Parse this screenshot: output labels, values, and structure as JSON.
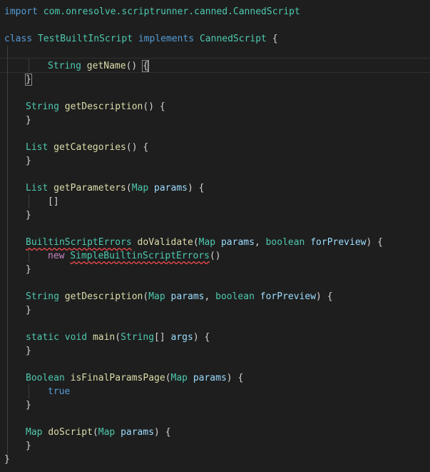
{
  "editor": {
    "lines": {
      "l1": {
        "t1": "import",
        "t2": " com.onresolve.scriptrunner.canned.CannedScript"
      },
      "l3": {
        "t1": "class",
        "t2": " ",
        "t3": "TestBuiltInScript",
        "t4": " ",
        "t5": "implements",
        "t6": " ",
        "t7": "CannedScript",
        "t8": " {"
      },
      "l5": {
        "t1": "String",
        "t2": " ",
        "t3": "getName",
        "t4": "() ",
        "t5": "{"
      },
      "l6": {
        "t1": "}"
      },
      "l8": {
        "t1": "String",
        "t2": " ",
        "t3": "getDescription",
        "t4": "() {"
      },
      "l9": {
        "t1": "}"
      },
      "l11": {
        "t1": "List",
        "t2": " ",
        "t3": "getCategories",
        "t4": "() {"
      },
      "l12": {
        "t1": "}"
      },
      "l14": {
        "t1": "List",
        "t2": " ",
        "t3": "getParameters",
        "t4": "(",
        "t5": "Map",
        "t6": " ",
        "t7": "params",
        "t8": ") {"
      },
      "l15": {
        "t1": "[]"
      },
      "l16": {
        "t1": "}"
      },
      "l18": {
        "t1": "BuiltinScriptErrors",
        "t2": " ",
        "t3": "doValidate",
        "t4": "(",
        "t5": "Map",
        "t6": " ",
        "t7": "params",
        "t8": ", ",
        "t9": "boolean",
        "t10": " ",
        "t11": "forPreview",
        "t12": ") {"
      },
      "l19": {
        "t1": "new",
        "t2": " ",
        "t3": "SimpleBuiltinScriptErrors",
        "t4": "()"
      },
      "l20": {
        "t1": "}"
      },
      "l22": {
        "t1": "String",
        "t2": " ",
        "t3": "getDescription",
        "t4": "(",
        "t5": "Map",
        "t6": " ",
        "t7": "params",
        "t8": ", ",
        "t9": "boolean",
        "t10": " ",
        "t11": "forPreview",
        "t12": ") {"
      },
      "l23": {
        "t1": "}"
      },
      "l25": {
        "t1": "static",
        "t2": " ",
        "t3": "void",
        "t4": " ",
        "t5": "main",
        "t6": "(",
        "t7": "String",
        "t8": "[] ",
        "t9": "args",
        "t10": ") {"
      },
      "l26": {
        "t1": "}"
      },
      "l28": {
        "t1": "Boolean",
        "t2": " ",
        "t3": "isFinalParamsPage",
        "t4": "(",
        "t5": "Map",
        "t6": " ",
        "t7": "params",
        "t8": ") {"
      },
      "l29": {
        "t1": "true"
      },
      "l30": {
        "t1": "}"
      },
      "l32": {
        "t1": "Map",
        "t2": " ",
        "t3": "doScript",
        "t4": "(",
        "t5": "Map",
        "t6": " ",
        "t7": "params",
        "t8": ") {"
      },
      "l33": {
        "t1": "}"
      },
      "l34": {
        "t1": "}"
      }
    }
  },
  "colors": {
    "background": "#1e1e1e",
    "keyword": "#569cd6",
    "type": "#4ec9b0",
    "function": "#dcdcaa",
    "variable": "#9cdcfe",
    "plain": "#d4d4d4",
    "control": "#c586c0",
    "error": "#f14c4c"
  }
}
